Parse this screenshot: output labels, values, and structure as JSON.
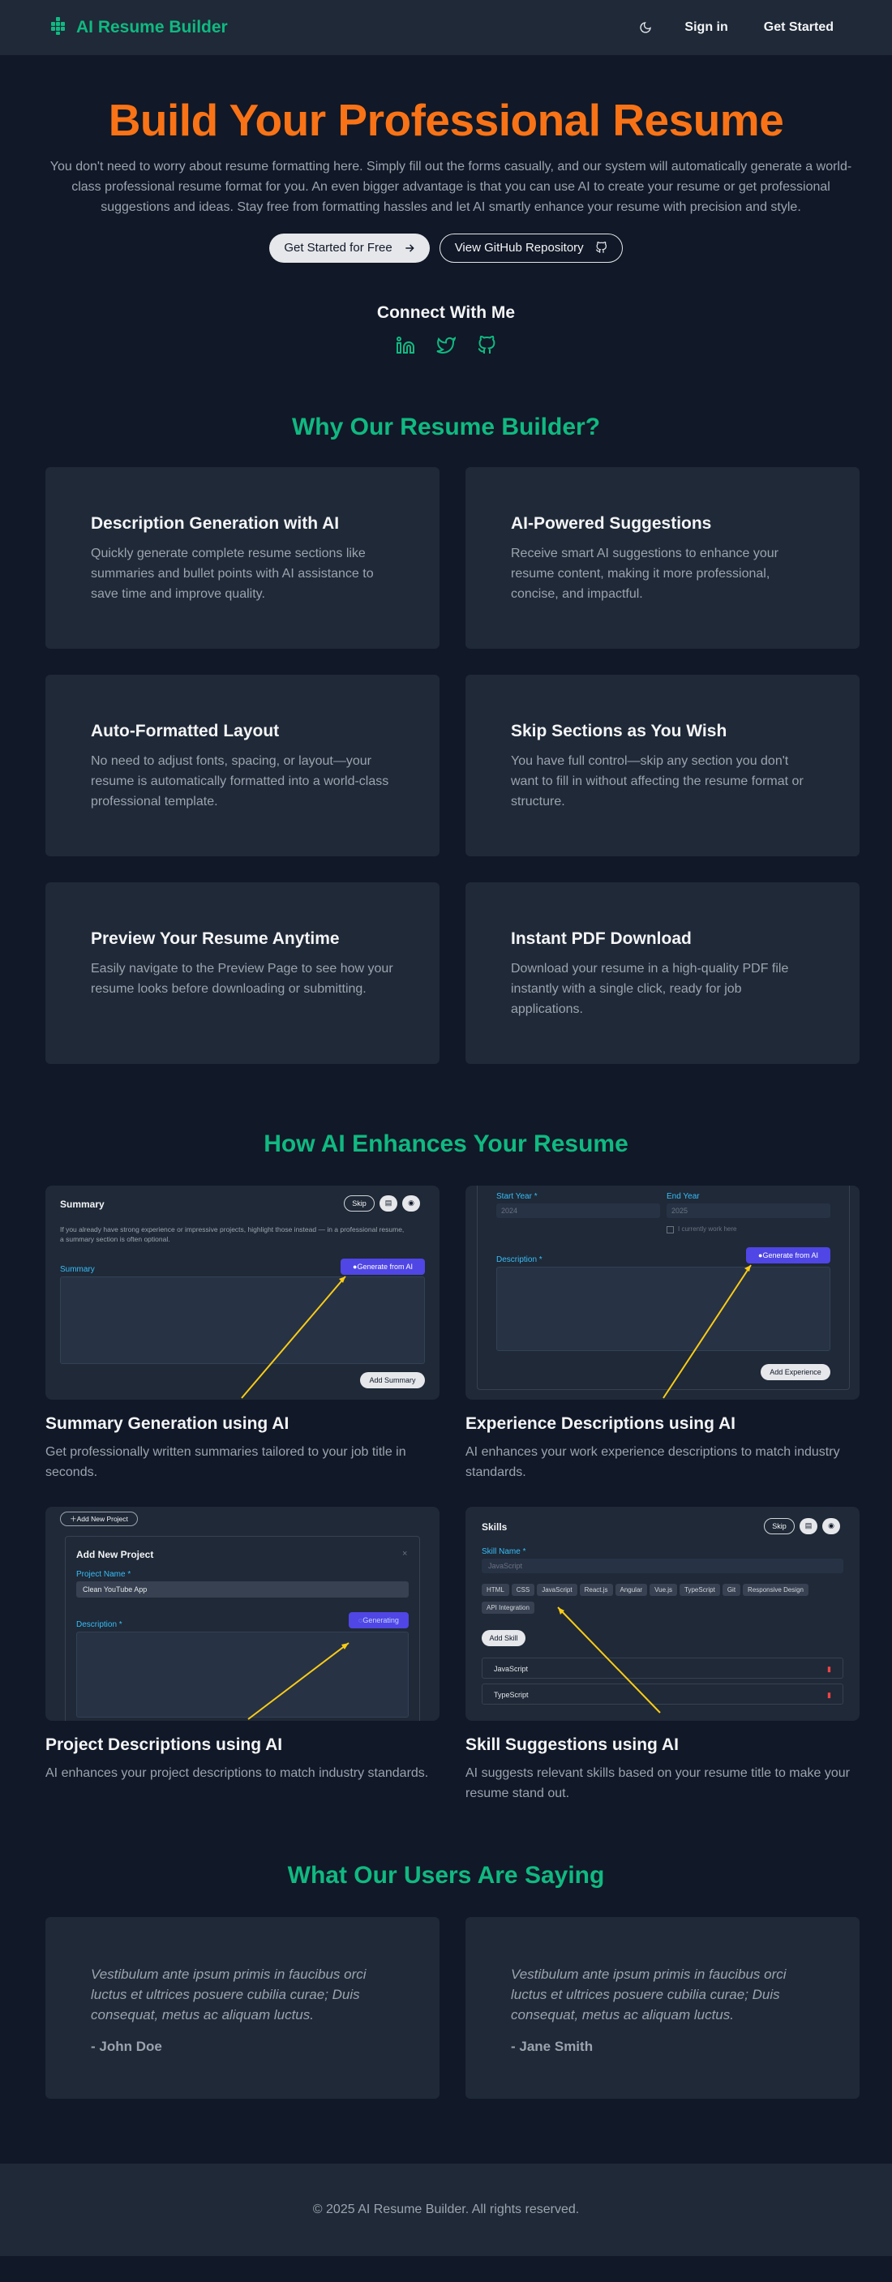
{
  "header": {
    "brand": "AI Resume Builder",
    "sign_in": "Sign in",
    "get_started": "Get Started"
  },
  "hero": {
    "title": "Build Your Professional Resume",
    "description": "You don't need to worry about resume formatting here. Simply fill out the forms casually, and our system will automatically generate a world-class professional resume format for you. An even bigger advantage is that you can use AI to create your resume or get professional suggestions and ideas. Stay free from formatting hassles and let AI smartly enhance your resume with precision and style.",
    "cta_primary": "Get Started for Free",
    "cta_secondary": "View GitHub Repository"
  },
  "connect": {
    "title": "Connect With Me"
  },
  "why": {
    "title": "Why Our Resume Builder?",
    "features": [
      {
        "title": "Description Generation with AI",
        "text": "Quickly generate complete resume sections like summaries and bullet points with AI assistance to save time and improve quality."
      },
      {
        "title": "AI-Powered Suggestions",
        "text": "Receive smart AI suggestions to enhance your resume content, making it more professional, concise, and impactful."
      },
      {
        "title": "Auto-Formatted Layout",
        "text": "No need to adjust fonts, spacing, or layout—your resume is automatically formatted into a world-class professional template."
      },
      {
        "title": "Skip Sections as You Wish",
        "text": "You have full control—skip any section you don't want to fill in without affecting the resume format or structure."
      },
      {
        "title": "Preview Your Resume Anytime",
        "text": "Easily navigate to the Preview Page to see how your resume looks before downloading or submitting."
      },
      {
        "title": "Instant PDF Download",
        "text": "Download your resume in a high-quality PDF file instantly with a single click, ready for job applications."
      }
    ]
  },
  "ai": {
    "title": "How AI Enhances Your Resume",
    "items": [
      {
        "title": "Summary Generation using AI",
        "text": "Get professionally written summaries tailored to your job title in seconds."
      },
      {
        "title": "Experience Descriptions using AI",
        "text": "AI enhances your work experience descriptions to match industry standards."
      },
      {
        "title": "Project Descriptions using AI",
        "text": "AI enhances your project descriptions to match industry standards."
      },
      {
        "title": "Skill Suggestions using AI",
        "text": "AI suggests relevant skills based on your resume title to make your resume stand out."
      }
    ],
    "shot_summary": {
      "heading": "Summary",
      "skip": "Skip",
      "hint": "If you already have strong experience or impressive projects, highlight those instead — in a professional resume, a summary section is often optional.",
      "label": "Summary",
      "generate": "Generate from AI",
      "add": "Add Summary"
    },
    "shot_experience": {
      "start_label": "Start Year *",
      "start_value": "2024",
      "end_label": "End Year",
      "end_value": "2025",
      "current": "I currently work here",
      "desc_label": "Description *",
      "generate": "Generate from AI",
      "add": "Add Experience"
    },
    "shot_project": {
      "add_new": "Add New Project",
      "modal_title": "Add New Project",
      "name_label": "Project Name *",
      "name_value": "Clean YouTube App",
      "desc_label": "Description *",
      "generating": "Generating"
    },
    "shot_skills": {
      "heading": "Skills",
      "skip": "Skip",
      "name_label": "Skill Name *",
      "name_placeholder": "JavaScript",
      "chips": [
        "HTML",
        "CSS",
        "JavaScript",
        "React.js",
        "Angular",
        "Vue.js",
        "TypeScript",
        "Git",
        "Responsive Design",
        "API Integration"
      ],
      "add": "Add Skill",
      "list": [
        "JavaScript",
        "TypeScript"
      ]
    }
  },
  "testimonials": {
    "title": "What Our Users Are Saying",
    "items": [
      {
        "quote": "Vestibulum ante ipsum primis in faucibus orci luctus et ultrices posuere cubilia curae; Duis consequat, metus ac aliquam luctus.",
        "author": "- John Doe"
      },
      {
        "quote": "Vestibulum ante ipsum primis in faucibus orci luctus et ultrices posuere cubilia curae; Duis consequat, metus ac aliquam luctus.",
        "author": "- Jane Smith"
      }
    ]
  },
  "footer": {
    "text": "© 2025 AI Resume Builder. All rights reserved."
  },
  "colors": {
    "accent": "#10b981",
    "hero_title": "#f97316",
    "bg": "#111827",
    "card": "#1f2937",
    "ai_button": "#4f46e5",
    "arrow": "#facc15"
  }
}
